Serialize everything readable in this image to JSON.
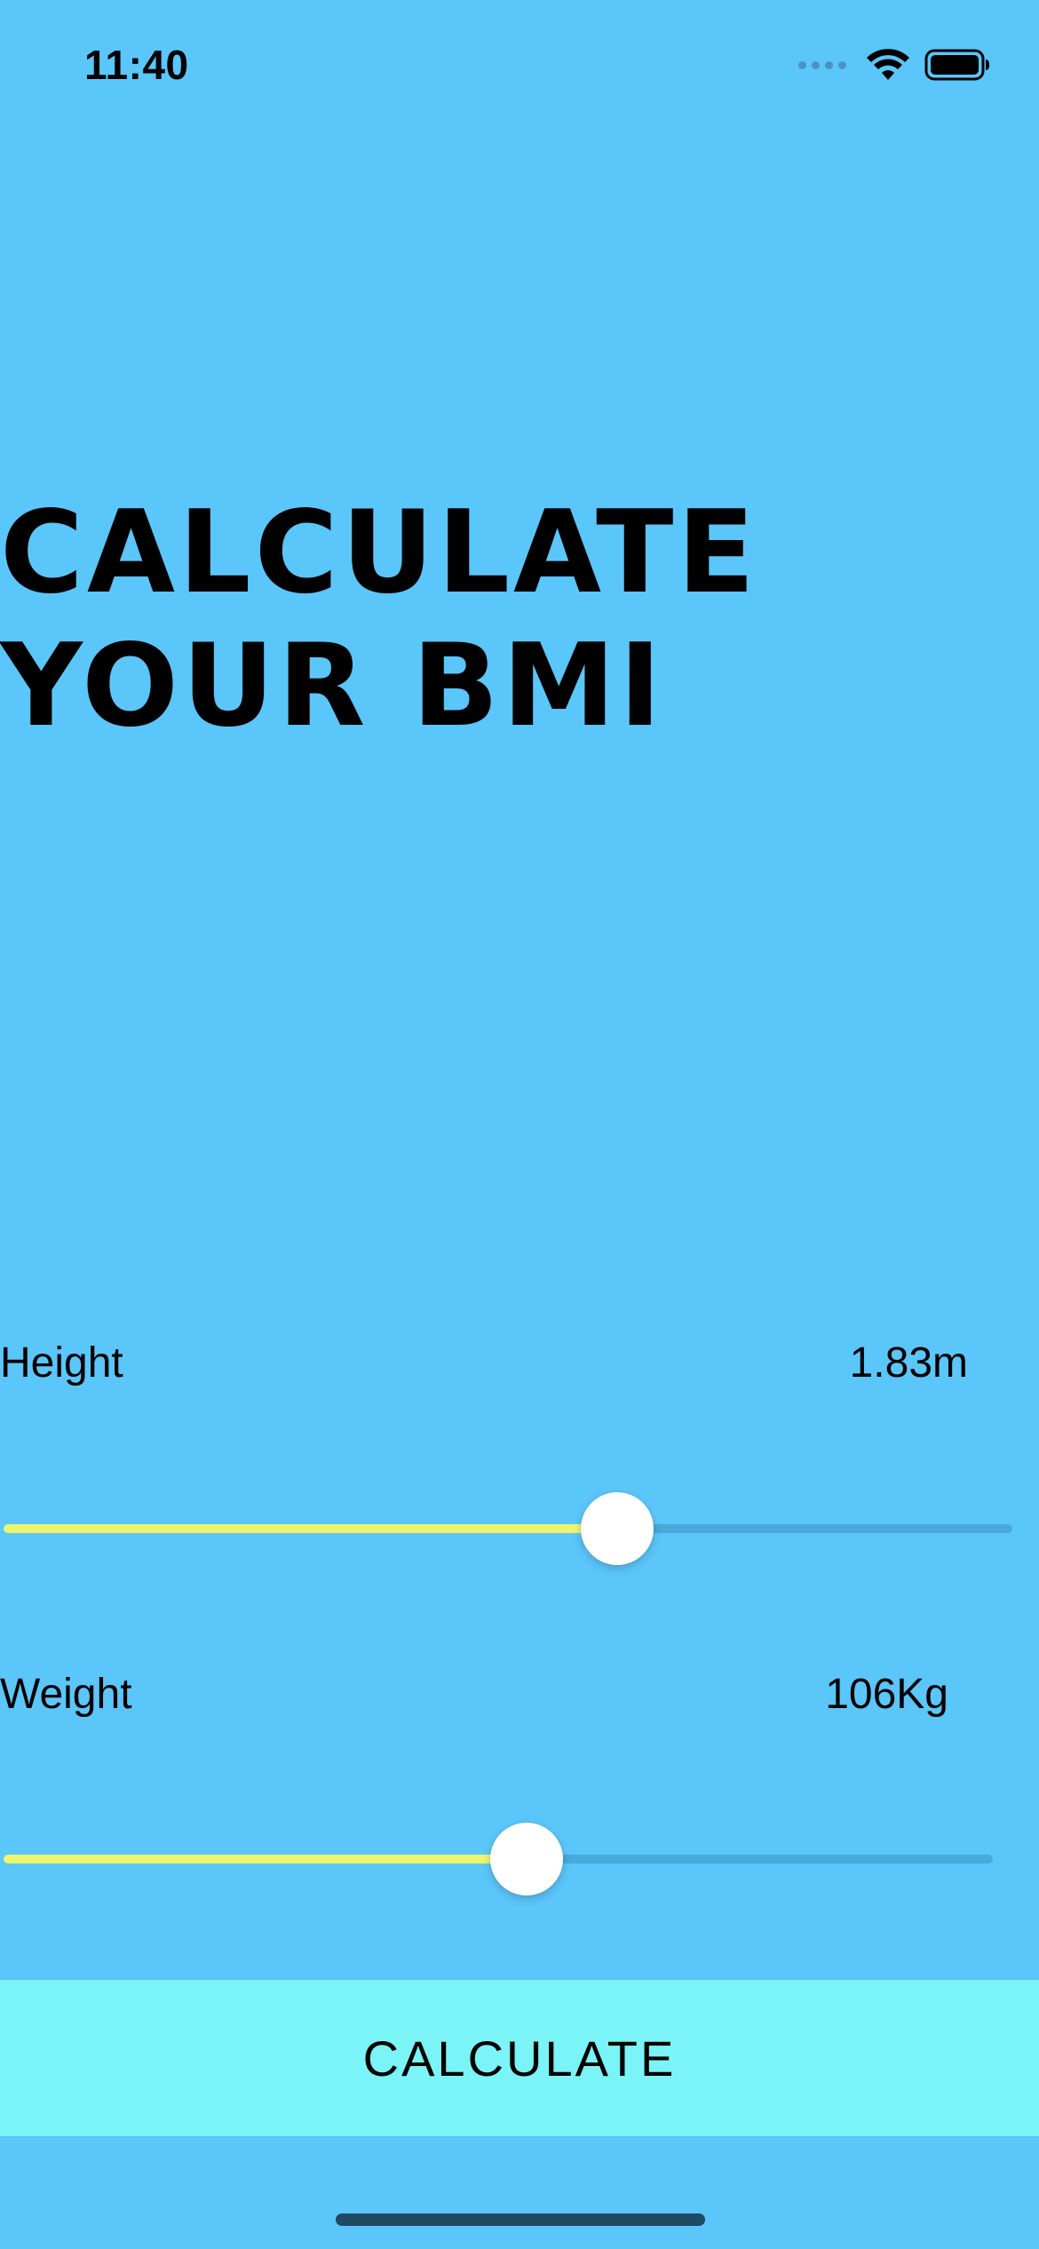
{
  "status_bar": {
    "time": "11:40",
    "icons": [
      "cellular-signal-icon",
      "wifi-icon",
      "battery-icon"
    ]
  },
  "title": {
    "line1": "CALCULATE",
    "line2": "YOUR BMI"
  },
  "height": {
    "label": "Height",
    "value": "1.83m",
    "slider_fraction": 0.61
  },
  "weight": {
    "label": "Weight",
    "value": "106Kg",
    "slider_fraction": 0.53
  },
  "calculate_button": {
    "label": "CALCULATE"
  },
  "colors": {
    "background": "#5BC6FA",
    "slider_fill": "#ECF56B",
    "slider_track": "#48A9DA",
    "button_background": "#7AF4F6"
  }
}
